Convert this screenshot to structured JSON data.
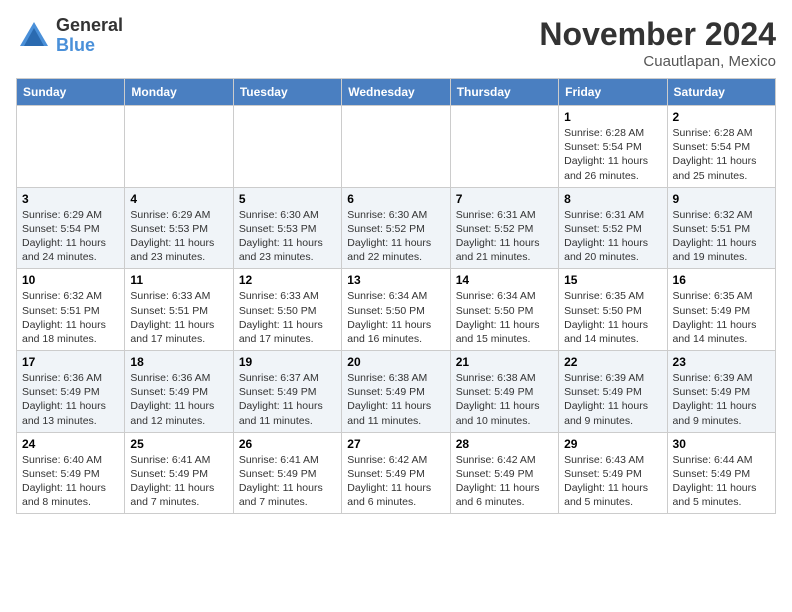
{
  "logo": {
    "general": "General",
    "blue": "Blue"
  },
  "title": "November 2024",
  "location": "Cuautlapan, Mexico",
  "days_header": [
    "Sunday",
    "Monday",
    "Tuesday",
    "Wednesday",
    "Thursday",
    "Friday",
    "Saturday"
  ],
  "weeks": [
    [
      {
        "day": "",
        "info": ""
      },
      {
        "day": "",
        "info": ""
      },
      {
        "day": "",
        "info": ""
      },
      {
        "day": "",
        "info": ""
      },
      {
        "day": "",
        "info": ""
      },
      {
        "day": "1",
        "info": "Sunrise: 6:28 AM\nSunset: 5:54 PM\nDaylight: 11 hours\nand 26 minutes."
      },
      {
        "day": "2",
        "info": "Sunrise: 6:28 AM\nSunset: 5:54 PM\nDaylight: 11 hours\nand 25 minutes."
      }
    ],
    [
      {
        "day": "3",
        "info": "Sunrise: 6:29 AM\nSunset: 5:54 PM\nDaylight: 11 hours\nand 24 minutes."
      },
      {
        "day": "4",
        "info": "Sunrise: 6:29 AM\nSunset: 5:53 PM\nDaylight: 11 hours\nand 23 minutes."
      },
      {
        "day": "5",
        "info": "Sunrise: 6:30 AM\nSunset: 5:53 PM\nDaylight: 11 hours\nand 23 minutes."
      },
      {
        "day": "6",
        "info": "Sunrise: 6:30 AM\nSunset: 5:52 PM\nDaylight: 11 hours\nand 22 minutes."
      },
      {
        "day": "7",
        "info": "Sunrise: 6:31 AM\nSunset: 5:52 PM\nDaylight: 11 hours\nand 21 minutes."
      },
      {
        "day": "8",
        "info": "Sunrise: 6:31 AM\nSunset: 5:52 PM\nDaylight: 11 hours\nand 20 minutes."
      },
      {
        "day": "9",
        "info": "Sunrise: 6:32 AM\nSunset: 5:51 PM\nDaylight: 11 hours\nand 19 minutes."
      }
    ],
    [
      {
        "day": "10",
        "info": "Sunrise: 6:32 AM\nSunset: 5:51 PM\nDaylight: 11 hours\nand 18 minutes."
      },
      {
        "day": "11",
        "info": "Sunrise: 6:33 AM\nSunset: 5:51 PM\nDaylight: 11 hours\nand 17 minutes."
      },
      {
        "day": "12",
        "info": "Sunrise: 6:33 AM\nSunset: 5:50 PM\nDaylight: 11 hours\nand 17 minutes."
      },
      {
        "day": "13",
        "info": "Sunrise: 6:34 AM\nSunset: 5:50 PM\nDaylight: 11 hours\nand 16 minutes."
      },
      {
        "day": "14",
        "info": "Sunrise: 6:34 AM\nSunset: 5:50 PM\nDaylight: 11 hours\nand 15 minutes."
      },
      {
        "day": "15",
        "info": "Sunrise: 6:35 AM\nSunset: 5:50 PM\nDaylight: 11 hours\nand 14 minutes."
      },
      {
        "day": "16",
        "info": "Sunrise: 6:35 AM\nSunset: 5:49 PM\nDaylight: 11 hours\nand 14 minutes."
      }
    ],
    [
      {
        "day": "17",
        "info": "Sunrise: 6:36 AM\nSunset: 5:49 PM\nDaylight: 11 hours\nand 13 minutes."
      },
      {
        "day": "18",
        "info": "Sunrise: 6:36 AM\nSunset: 5:49 PM\nDaylight: 11 hours\nand 12 minutes."
      },
      {
        "day": "19",
        "info": "Sunrise: 6:37 AM\nSunset: 5:49 PM\nDaylight: 11 hours\nand 11 minutes."
      },
      {
        "day": "20",
        "info": "Sunrise: 6:38 AM\nSunset: 5:49 PM\nDaylight: 11 hours\nand 11 minutes."
      },
      {
        "day": "21",
        "info": "Sunrise: 6:38 AM\nSunset: 5:49 PM\nDaylight: 11 hours\nand 10 minutes."
      },
      {
        "day": "22",
        "info": "Sunrise: 6:39 AM\nSunset: 5:49 PM\nDaylight: 11 hours\nand 9 minutes."
      },
      {
        "day": "23",
        "info": "Sunrise: 6:39 AM\nSunset: 5:49 PM\nDaylight: 11 hours\nand 9 minutes."
      }
    ],
    [
      {
        "day": "24",
        "info": "Sunrise: 6:40 AM\nSunset: 5:49 PM\nDaylight: 11 hours\nand 8 minutes."
      },
      {
        "day": "25",
        "info": "Sunrise: 6:41 AM\nSunset: 5:49 PM\nDaylight: 11 hours\nand 7 minutes."
      },
      {
        "day": "26",
        "info": "Sunrise: 6:41 AM\nSunset: 5:49 PM\nDaylight: 11 hours\nand 7 minutes."
      },
      {
        "day": "27",
        "info": "Sunrise: 6:42 AM\nSunset: 5:49 PM\nDaylight: 11 hours\nand 6 minutes."
      },
      {
        "day": "28",
        "info": "Sunrise: 6:42 AM\nSunset: 5:49 PM\nDaylight: 11 hours\nand 6 minutes."
      },
      {
        "day": "29",
        "info": "Sunrise: 6:43 AM\nSunset: 5:49 PM\nDaylight: 11 hours\nand 5 minutes."
      },
      {
        "day": "30",
        "info": "Sunrise: 6:44 AM\nSunset: 5:49 PM\nDaylight: 11 hours\nand 5 minutes."
      }
    ]
  ]
}
